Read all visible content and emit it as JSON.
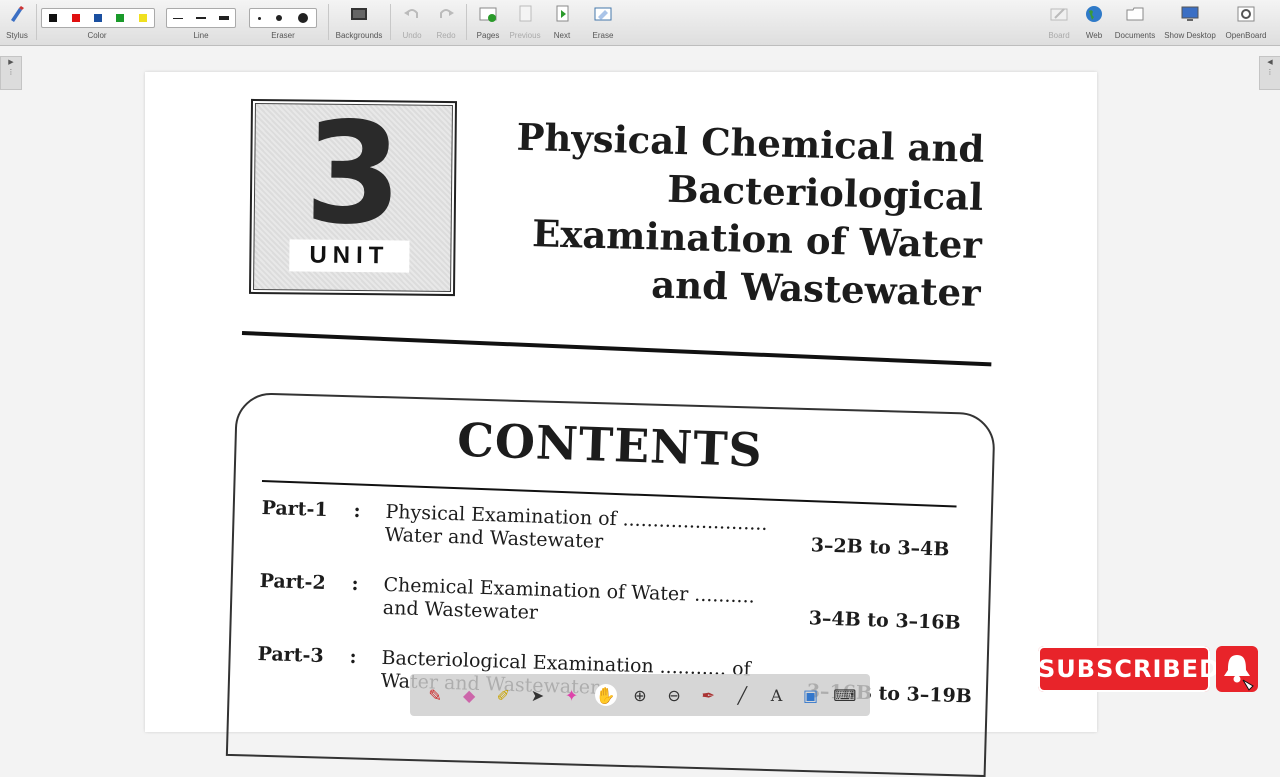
{
  "toolbar": {
    "stylus": "Stylus",
    "color": "Color",
    "line": "Line",
    "eraser": "Eraser",
    "backgrounds": "Backgrounds",
    "undo": "Undo",
    "redo": "Redo",
    "pages": "Pages",
    "previous": "Previous",
    "next": "Next",
    "erase": "Erase",
    "board": "Board",
    "web": "Web",
    "documents": "Documents",
    "show_desktop": "Show Desktop",
    "openboard": "OpenBoard"
  },
  "colors": {
    "swatches": [
      "#111111",
      "#e01010",
      "#1a4fa0",
      "#1a9a2a",
      "#f0e020"
    ],
    "subscribe_red": "#e8242a"
  },
  "document": {
    "unit_number": "3",
    "unit_label": "UNIT",
    "title_lines": [
      "Physical Chemical and",
      "Bacteriological",
      "Examination of Water",
      "and Wastewater"
    ],
    "contents_heading": "CONTENTS",
    "parts": [
      {
        "part": "Part-1",
        "colon": ":",
        "desc": "Physical Examination of ........................ Water and Wastewater",
        "range": "3–2B to 3–4B"
      },
      {
        "part": "Part-2",
        "colon": ":",
        "desc": "Chemical Examination of Water .......... and Wastewater",
        "range": "3–4B to 3–16B"
      },
      {
        "part": "Part-3",
        "colon": ":",
        "desc": "Bacteriological Examination ........... of Water and Wastewater",
        "range": "3–16B to 3–19B"
      }
    ]
  },
  "overlay": {
    "subscribed": "SUBSCRIBED"
  }
}
